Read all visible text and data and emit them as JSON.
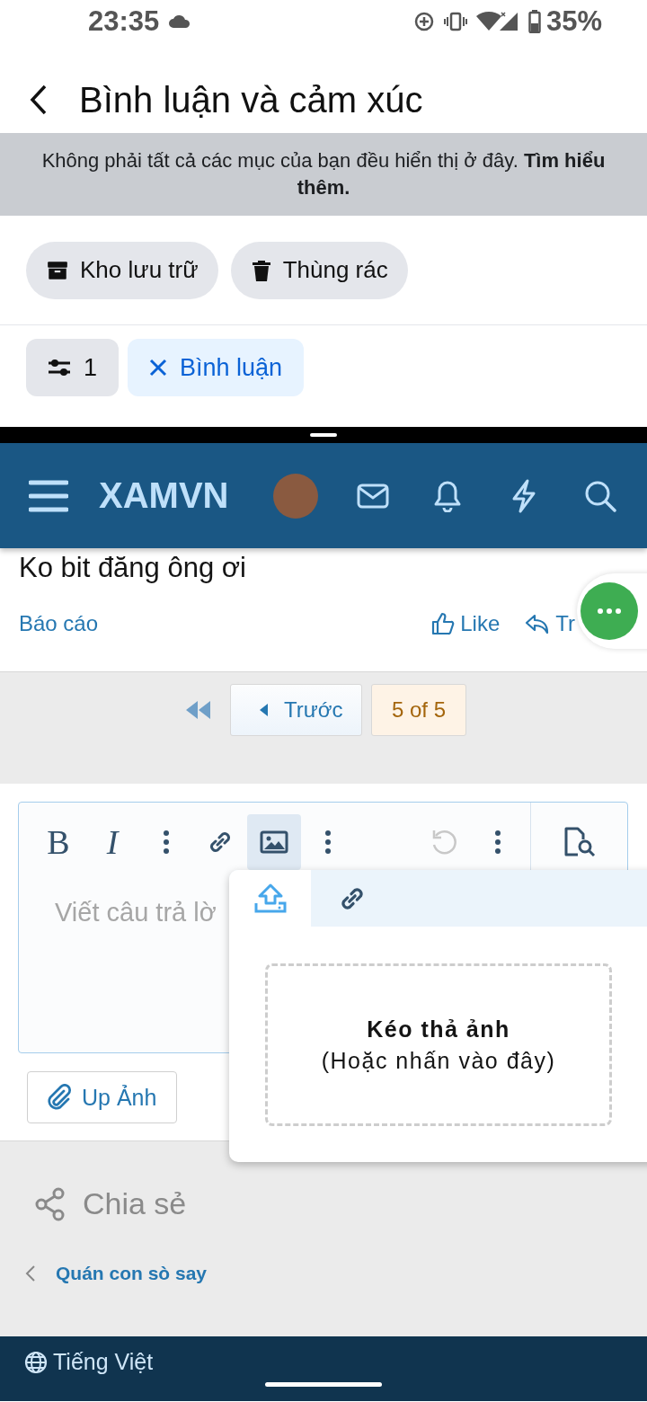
{
  "status_bar": {
    "time": "23:35",
    "battery": "35%"
  },
  "app_bar": {
    "title": "Bình luận và cảm xúc"
  },
  "notice": {
    "text": "Không phải tất cả các mục của bạn đều hiển thị ở đây. **Tìm hiểu thêm.**"
  },
  "chips": [
    {
      "kind": "archive",
      "label": "Kho lưu trữ"
    },
    {
      "kind": "trash",
      "label": "Thùng rác"
    }
  ],
  "filters": {
    "count": "1",
    "active_filter": "Bình luận"
  },
  "site_header": {
    "logo": "XAMVN"
  },
  "post": {
    "text": "Ko bit đăng ông ơi",
    "report": "Báo cáo",
    "like": "Like",
    "reply": "Tr"
  },
  "pagination": {
    "previous": "Trước",
    "current": "5 of 5"
  },
  "editor": {
    "placeholder": "Viết câu trả lờ",
    "tools": [
      {
        "kind": "bold",
        "label": "B",
        "active": false
      },
      {
        "kind": "italic",
        "label": "I",
        "active": false
      },
      {
        "kind": "more",
        "active": false
      },
      {
        "kind": "link",
        "active": false
      },
      {
        "kind": "image",
        "active": true
      },
      {
        "kind": "more",
        "active": false
      }
    ],
    "history_tools": [
      {
        "kind": "undo",
        "disabled": true
      },
      {
        "kind": "more",
        "disabled": false
      }
    ]
  },
  "upload_popup": {
    "tabs": [
      {
        "kind": "upload",
        "selected": true
      },
      {
        "kind": "link",
        "selected": false
      }
    ],
    "drop_title": "Kéo thả ảnh",
    "drop_hint": "(Hoặc nhấn vào đây)"
  },
  "attach_button": "Up Ảnh",
  "share": "Chia sẻ",
  "breadcrumb": "Quán con sò say",
  "footer": {
    "language": "Tiếng Việt"
  }
}
